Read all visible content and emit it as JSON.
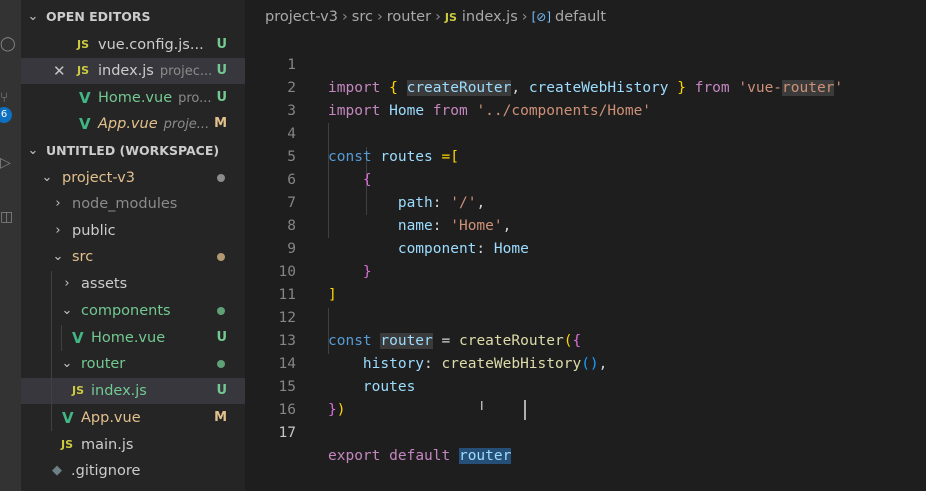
{
  "activity": {
    "badge": "6"
  },
  "sidebar": {
    "open_editors_title": "OPEN EDITORS",
    "open_editors": [
      {
        "name": "vue.config.js...",
        "folder": "",
        "status": "U"
      },
      {
        "name": "index.js",
        "folder": "projec...",
        "status": "U"
      },
      {
        "name": "Home.vue",
        "folder": "pro...",
        "status": "U"
      },
      {
        "name": "App.vue",
        "folder": "proje...",
        "status": "M"
      }
    ],
    "workspace_title": "UNTITLED (WORKSPACE)",
    "tree": [
      {
        "name": "project-v3"
      },
      {
        "name": "node_modules"
      },
      {
        "name": "public"
      },
      {
        "name": "src"
      },
      {
        "name": "assets"
      },
      {
        "name": "components"
      },
      {
        "name": "Home.vue",
        "status": "U"
      },
      {
        "name": "router"
      },
      {
        "name": "index.js",
        "status": "U"
      },
      {
        "name": "App.vue",
        "status": "M"
      },
      {
        "name": "main.js"
      },
      {
        "name": ".gitignore"
      }
    ]
  },
  "breadcrumb": {
    "items": [
      "project-v3",
      "src",
      "router",
      "index.js",
      "default"
    ]
  },
  "editor": {
    "line_numbers": [
      "1",
      "2",
      "3",
      "4",
      "5",
      "6",
      "7",
      "8",
      "9",
      "10",
      "11",
      "12",
      "13",
      "14",
      "15",
      "16",
      "17"
    ],
    "tokens": {
      "import": "import",
      "from": "from",
      "lbrace": "{",
      "rbrace": "}",
      "comma": ",",
      "createRouter": "createRouter",
      "createWebHistory": "createWebHistory",
      "vue_router_a": "'vue-",
      "vue_router_b": "router",
      "vue_router_c": "'",
      "home": "Home",
      "home_path": "'../components/Home'",
      "const": "const",
      "routes": "routes",
      "eq_bracket": " =[",
      "lbracket": "[",
      "rbracket": "]",
      "path": "path",
      "colon": ":",
      "path_val": "'/'",
      "name": "name",
      "name_val": "'Home'",
      "component": "component",
      "router": "router",
      "eq": " = ",
      "lparen": "(",
      "rparen": ")",
      "history": "history",
      "empty_parens": "()",
      "export": "export",
      "default": "default"
    }
  }
}
